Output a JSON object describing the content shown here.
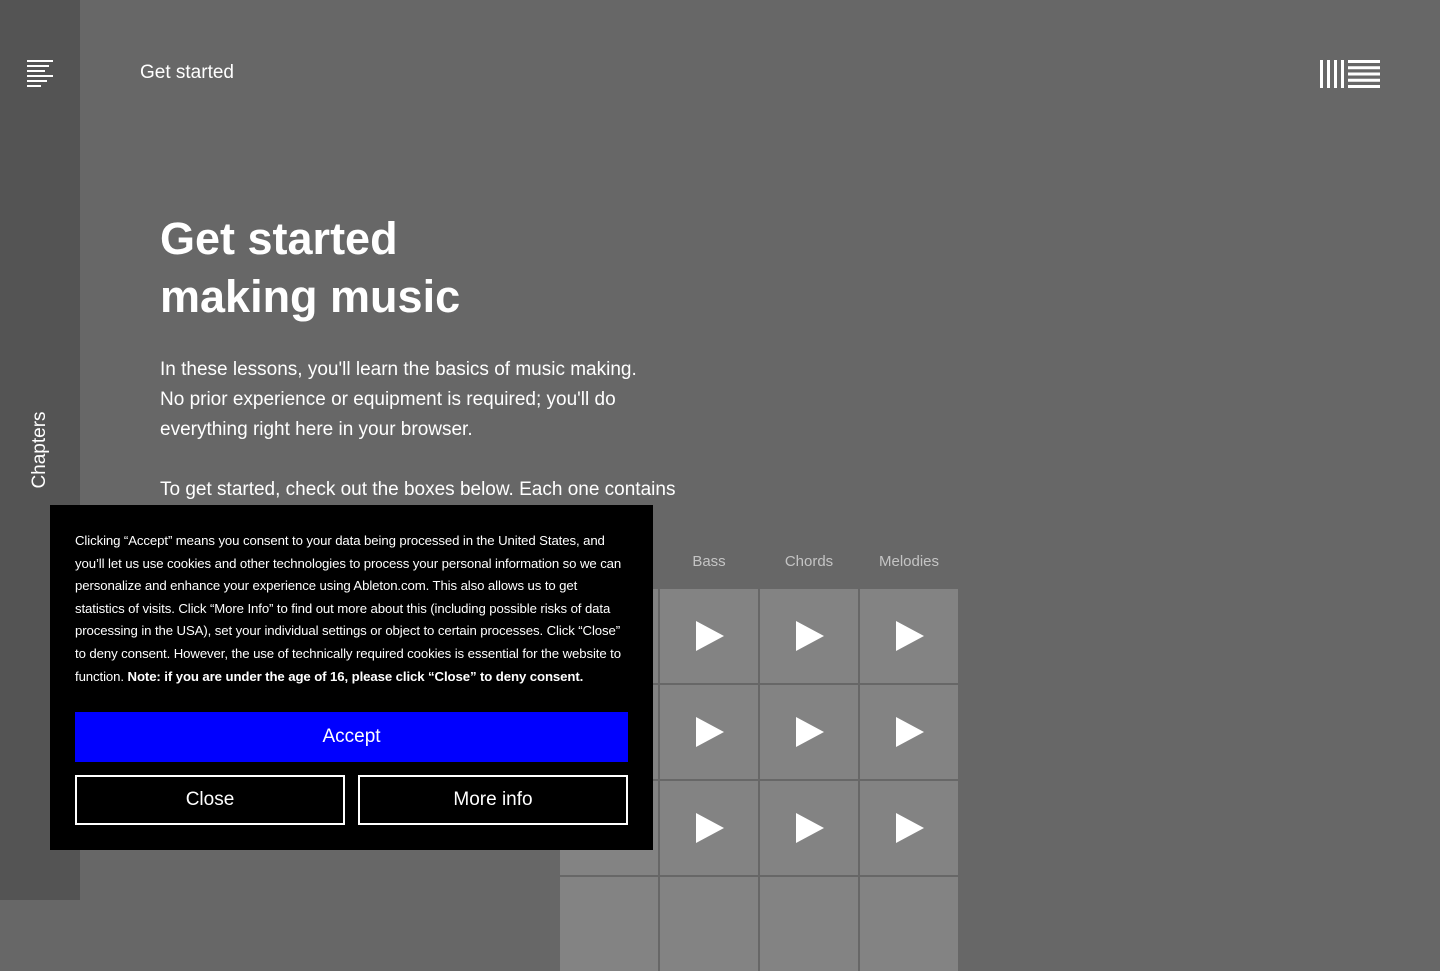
{
  "sidebar": {
    "menu_icon": "hamburger-menu-icon",
    "chapters_label": "Chapters"
  },
  "header": {
    "title": "Get started",
    "logo_icon": "ableton-logo-icon"
  },
  "main": {
    "headline_line1": "Get started",
    "headline_line2": "making music",
    "intro": "In these lessons, you'll learn the basics of music making. No prior experience or equipment is required; you'll do everything right here in your browser.",
    "intro2": "To get started, check out the boxes below. Each one contains"
  },
  "grid": {
    "columns": [
      "Bass",
      "Chords",
      "Melodies"
    ],
    "pad_icon": "play-icon"
  },
  "cookie_banner": {
    "text": "Clicking “Accept” means you consent to your data being processed in the United States, and you’ll let us use cookies and other technologies to process your personal information so we can personalize and enhance your experience using Ableton.com. This also allows us to get statistics of visits. Click “More Info” to find out more about this (including possible risks of data processing in the USA), set your individual settings or object to certain processes. Click “Close” to deny consent. However, the use of technically required cookies is essential for the website to function.",
    "note": "Note: if you are under the age of 16, please click “Close” to deny consent.",
    "accept_label": "Accept",
    "close_label": "Close",
    "more_info_label": "More info"
  },
  "colors": {
    "background": "#676767",
    "sidebar": "#545454",
    "pad": "#838383",
    "accept": "#0000ff",
    "banner": "#000000"
  }
}
